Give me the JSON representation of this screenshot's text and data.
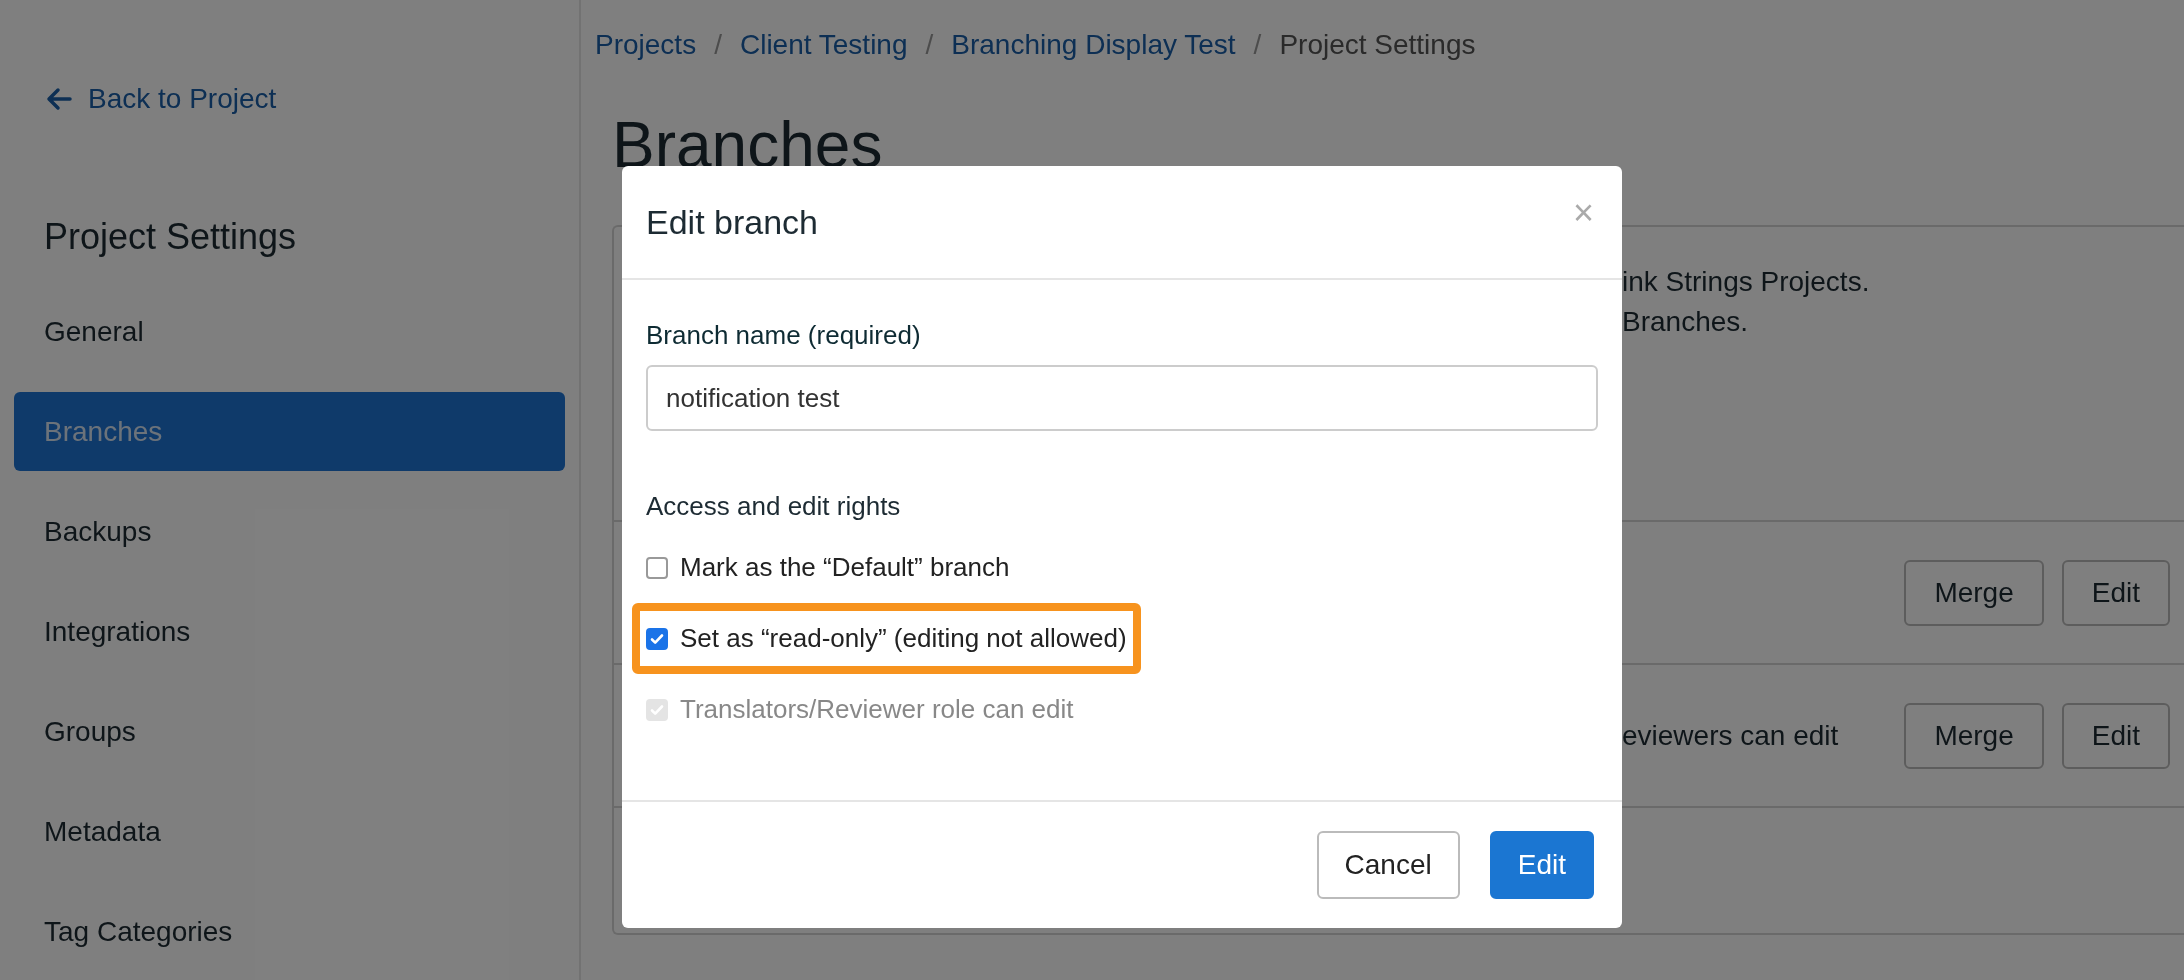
{
  "sidebar": {
    "back_link": "Back to Project",
    "title": "Project Settings",
    "items": [
      {
        "label": "General",
        "selected": false
      },
      {
        "label": "Branches",
        "selected": true
      },
      {
        "label": "Backups",
        "selected": false
      },
      {
        "label": "Integrations",
        "selected": false
      },
      {
        "label": "Groups",
        "selected": false
      },
      {
        "label": "Metadata",
        "selected": false
      },
      {
        "label": "Tag Categories",
        "selected": false
      }
    ]
  },
  "breadcrumb": {
    "separator": "/",
    "items": [
      {
        "label": "Projects",
        "current": false
      },
      {
        "label": "Client Testing",
        "current": false
      },
      {
        "label": "Branching Display Test",
        "current": false
      },
      {
        "label": "Project Settings",
        "current": true
      }
    ]
  },
  "page_title": "Branches",
  "background_card": {
    "description_lines": [
      "ink Strings Projects.",
      "Branches."
    ],
    "rows": [
      {
        "buttons": [
          "Merge",
          "Edit"
        ]
      },
      {
        "text": "eviewers can edit",
        "buttons": [
          "Merge",
          "Edit"
        ]
      }
    ]
  },
  "modal": {
    "title": "Edit branch",
    "close": "×",
    "field": {
      "label": "Branch name (required)",
      "value": "notification test"
    },
    "section_label": "Access and edit rights",
    "options": [
      {
        "label": "Mark as the “Default” branch",
        "checked": false,
        "disabled": false,
        "highlighted": false
      },
      {
        "label": "Set as “read-only” (editing not allowed)",
        "checked": true,
        "disabled": false,
        "highlighted": true
      },
      {
        "label": "Translators/Reviewer role can edit",
        "checked": true,
        "disabled": true,
        "highlighted": false
      }
    ],
    "buttons": [
      {
        "label": "Cancel",
        "kind": "secondary"
      },
      {
        "label": "Edit",
        "kind": "primary"
      }
    ]
  }
}
